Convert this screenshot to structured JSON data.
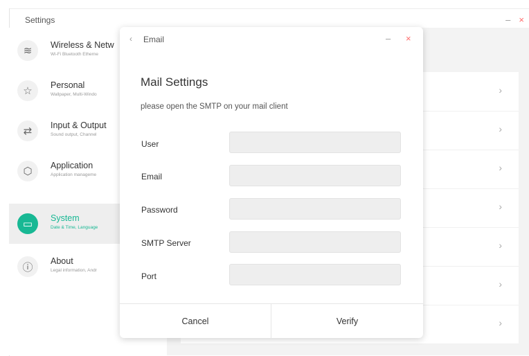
{
  "window": {
    "title": "Settings",
    "minimize": "–",
    "close": "×"
  },
  "sidebar": {
    "items": [
      {
        "title": "Wireless & Netw",
        "subtitle": "Wi-Fi Bluetooth Etherne",
        "icon": "wifi-icon",
        "glyph": "≋"
      },
      {
        "title": "Personal",
        "subtitle": "Wallpaper, Multi-Windo",
        "icon": "star-icon",
        "glyph": "☆"
      },
      {
        "title": "Input & Output",
        "subtitle": "Sound output, Channel",
        "icon": "swap-arrows-icon",
        "glyph": "⇄"
      },
      {
        "title": "Application",
        "subtitle": "Application manageme",
        "icon": "app-cube-icon",
        "glyph": "⬡"
      },
      {
        "title": "System",
        "subtitle": "Date & Time, Language",
        "icon": "monitor-icon",
        "glyph": "▭",
        "active": true
      },
      {
        "title": "About",
        "subtitle": "Legal information, Andr",
        "icon": "info-icon",
        "glyph": "ⓘ"
      }
    ]
  },
  "content": {
    "chevron": "›",
    "row_count": 7
  },
  "dialog": {
    "back": "‹",
    "title": "Email",
    "minimize": "–",
    "close": "×",
    "heading": "Mail Settings",
    "hint": "please open the SMTP on your mail client",
    "fields": [
      {
        "label": "User",
        "value": ""
      },
      {
        "label": "Email",
        "value": ""
      },
      {
        "label": "Password",
        "value": ""
      },
      {
        "label": "SMTP Server",
        "value": ""
      },
      {
        "label": "Port",
        "value": ""
      }
    ],
    "cancel_label": "Cancel",
    "verify_label": "Verify"
  },
  "colors": {
    "accent": "#18b894",
    "close": "#ff6b6b",
    "content_bg": "#f3f3f3",
    "active_item_bg": "#eeeeee",
    "input_bg": "#eeeeee"
  }
}
